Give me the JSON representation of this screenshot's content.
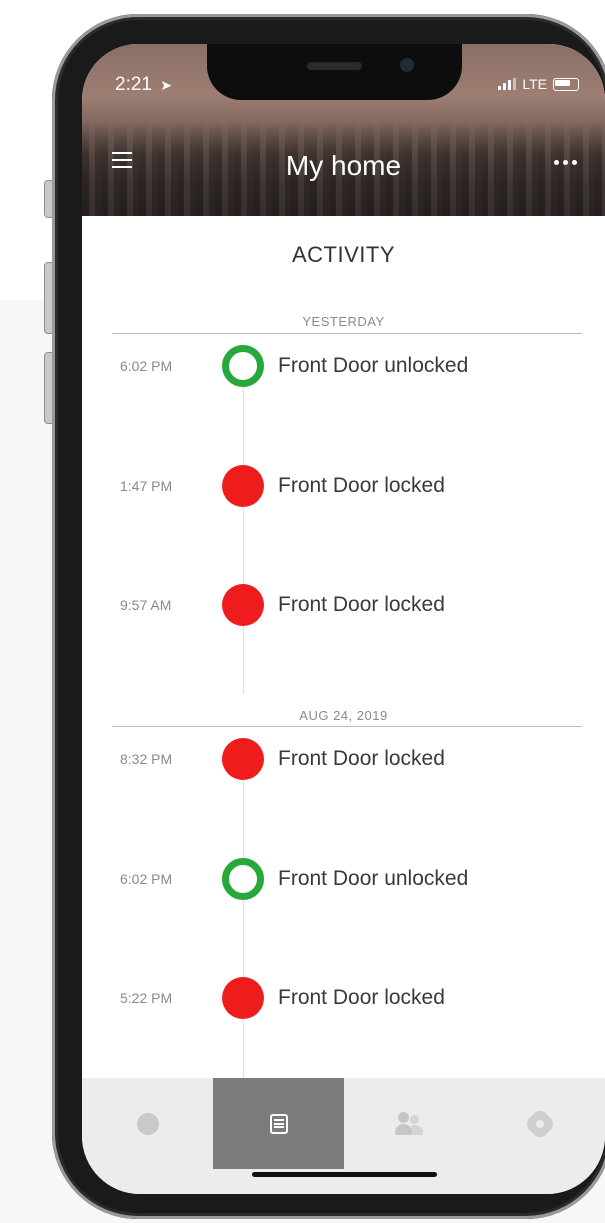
{
  "status_bar": {
    "time": "2:21",
    "carrier": "LTE"
  },
  "header": {
    "title": "My home",
    "menu_icon": "hamburger-menu-icon",
    "more_icon": "more-horizontal-icon"
  },
  "activity": {
    "title": "ACTIVITY",
    "sections": [
      {
        "label": "YESTERDAY",
        "events": [
          {
            "time": "6:02 PM",
            "text": "Front Door unlocked",
            "status": "unlocked"
          },
          {
            "time": "1:47 PM",
            "text": "Front Door locked",
            "status": "locked"
          },
          {
            "time": "9:57 AM",
            "text": "Front Door locked",
            "status": "locked"
          }
        ]
      },
      {
        "label": "AUG 24, 2019",
        "events": [
          {
            "time": "8:32 PM",
            "text": "Front Door locked",
            "status": "locked"
          },
          {
            "time": "6:02 PM",
            "text": "Front Door unlocked",
            "status": "unlocked"
          },
          {
            "time": "5:22 PM",
            "text": "Front Door locked",
            "status": "locked"
          }
        ]
      }
    ]
  },
  "colors": {
    "locked": "#ee1c1c",
    "unlocked": "#27a83a",
    "active_tab": "#7b7b7b"
  },
  "tabbar": {
    "tabs": [
      {
        "icon": "home-dot-icon",
        "active": false
      },
      {
        "icon": "activity-list-icon",
        "active": true
      },
      {
        "icon": "users-icon",
        "active": false
      },
      {
        "icon": "settings-gear-icon",
        "active": false
      }
    ]
  }
}
